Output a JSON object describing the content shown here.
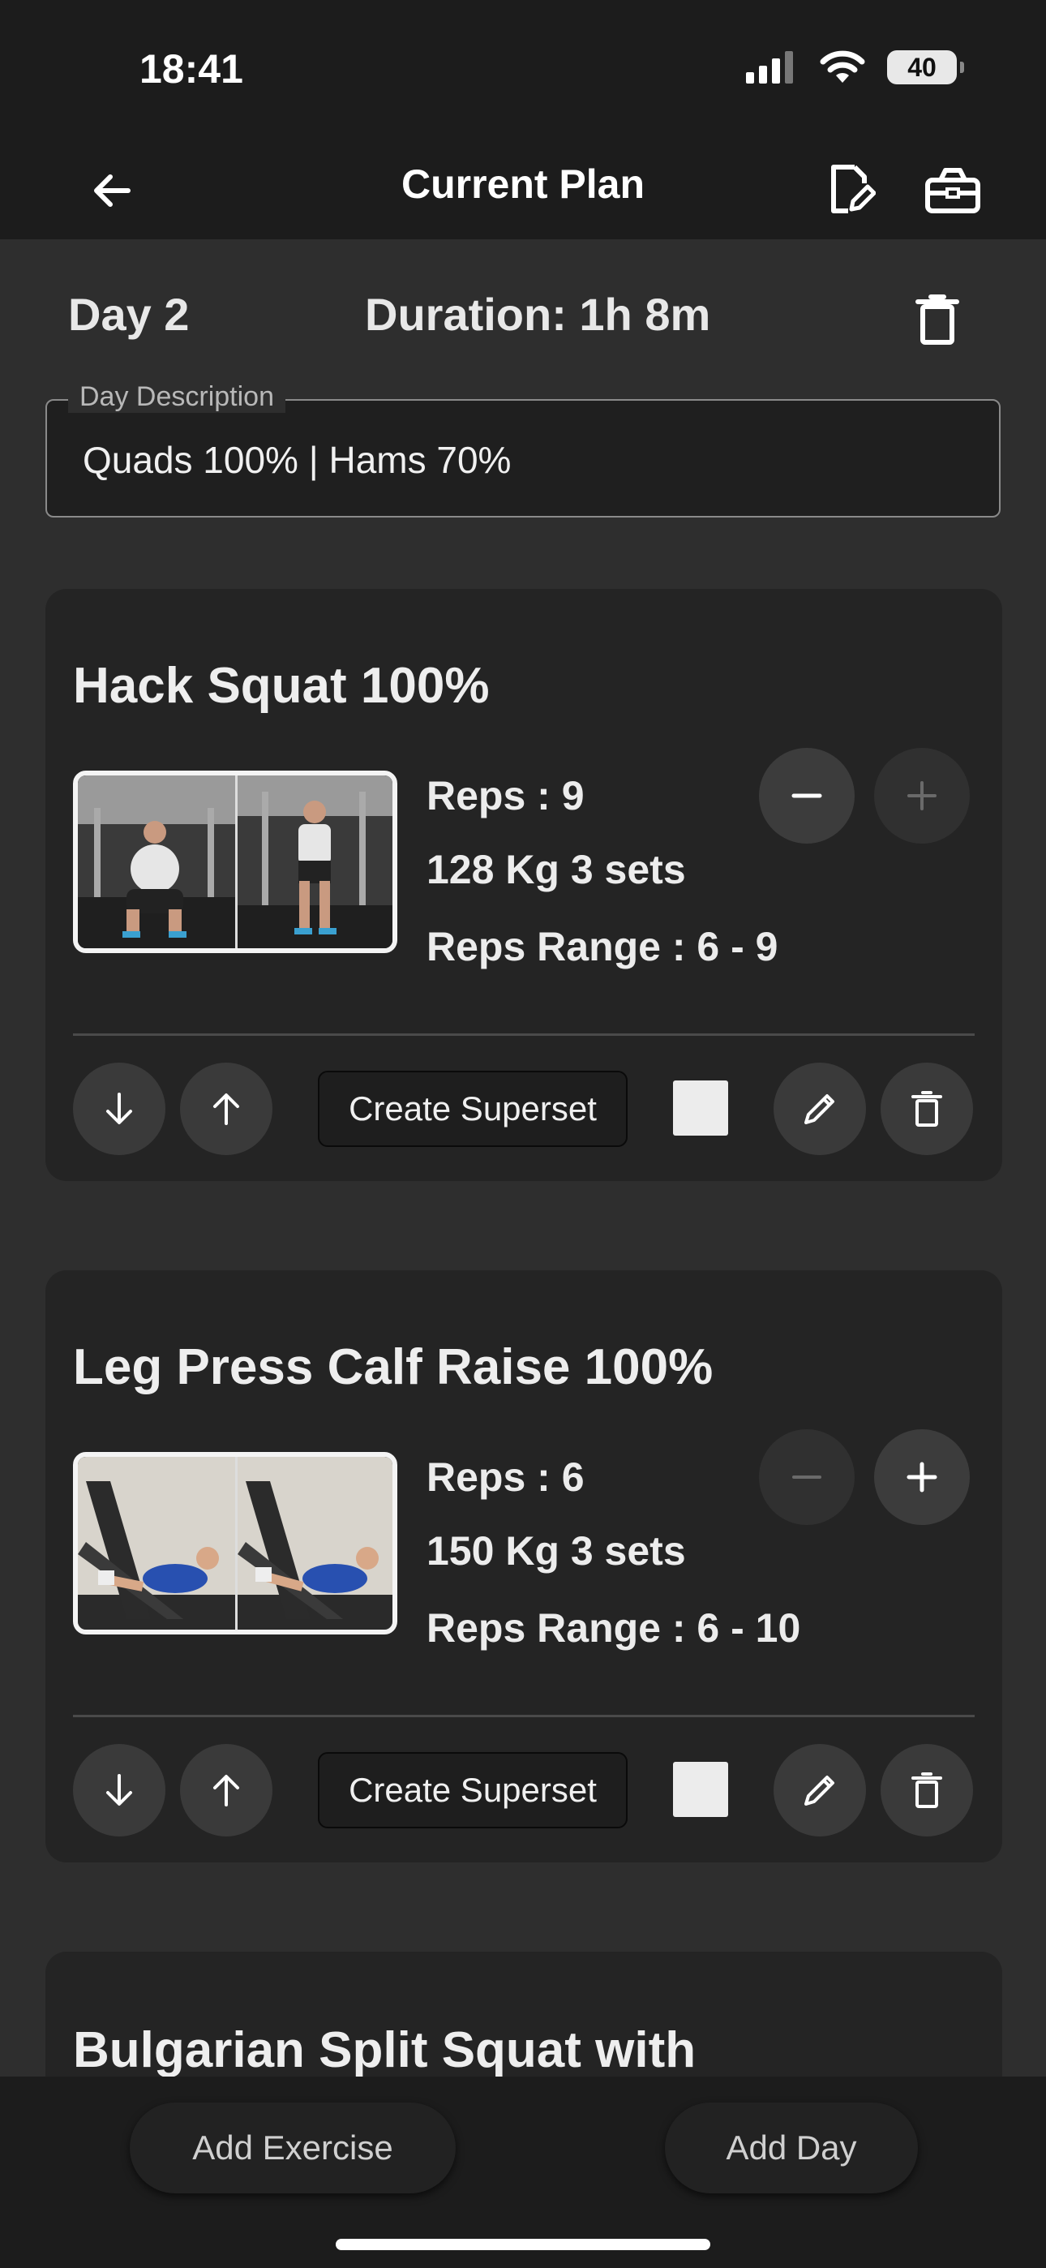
{
  "status_bar": {
    "time": "18:41",
    "battery": "40"
  },
  "nav": {
    "title": "Current  Plan"
  },
  "day": {
    "label": "Day  2",
    "duration": "Duration: 1h 8m"
  },
  "description": {
    "legend": "Day Description",
    "value": "Quads 100% | Hams 70%"
  },
  "exercises": [
    {
      "title": "Hack Squat 100%",
      "reps": "Reps : 9",
      "weight_sets": "128 Kg 3 sets",
      "reps_range": "Reps Range :  6 - 9",
      "superset_label": "Create Superset",
      "minus_enabled": true,
      "plus_enabled": false
    },
    {
      "title": "Leg Press Calf Raise 100%",
      "reps": "Reps : 6",
      "weight_sets": "150 Kg 3 sets",
      "reps_range": "Reps Range :  6 - 10",
      "superset_label": "Create Superset",
      "minus_enabled": false,
      "plus_enabled": true
    },
    {
      "title": "Bulgarian Split Squat with"
    }
  ],
  "bottom": {
    "add_exercise": "Add Exercise",
    "add_day": "Add Day"
  }
}
